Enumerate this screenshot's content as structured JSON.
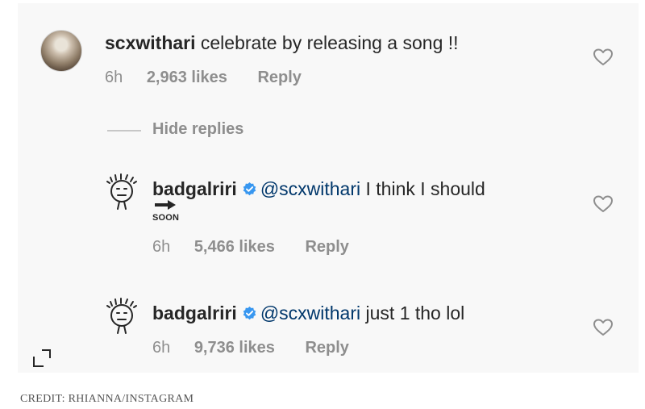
{
  "comments": [
    {
      "username": "scxwithari",
      "text": "celebrate by releasing a song !!",
      "time": "6h",
      "likes": "2,963 likes",
      "reply": "Reply"
    },
    {
      "username": "badgalriri",
      "mention": "@scxwithari",
      "text": "I think I should",
      "sticker_text": "SOON",
      "time": "6h",
      "likes": "5,466 likes",
      "reply": "Reply"
    },
    {
      "username": "badgalriri",
      "mention": "@scxwithari",
      "text": "just 1 tho lol",
      "time": "6h",
      "likes": "9,736 likes",
      "reply": "Reply"
    }
  ],
  "hide_replies": "Hide replies",
  "credit": "CREDIT: RHIANNA/INSTAGRAM",
  "icons": [
    "heart-icon",
    "verified-badge-icon",
    "crop-icon"
  ],
  "colors": {
    "text": "#262626",
    "muted": "#8e8e8e",
    "mention": "#00376b",
    "verified": "#3897f0"
  }
}
